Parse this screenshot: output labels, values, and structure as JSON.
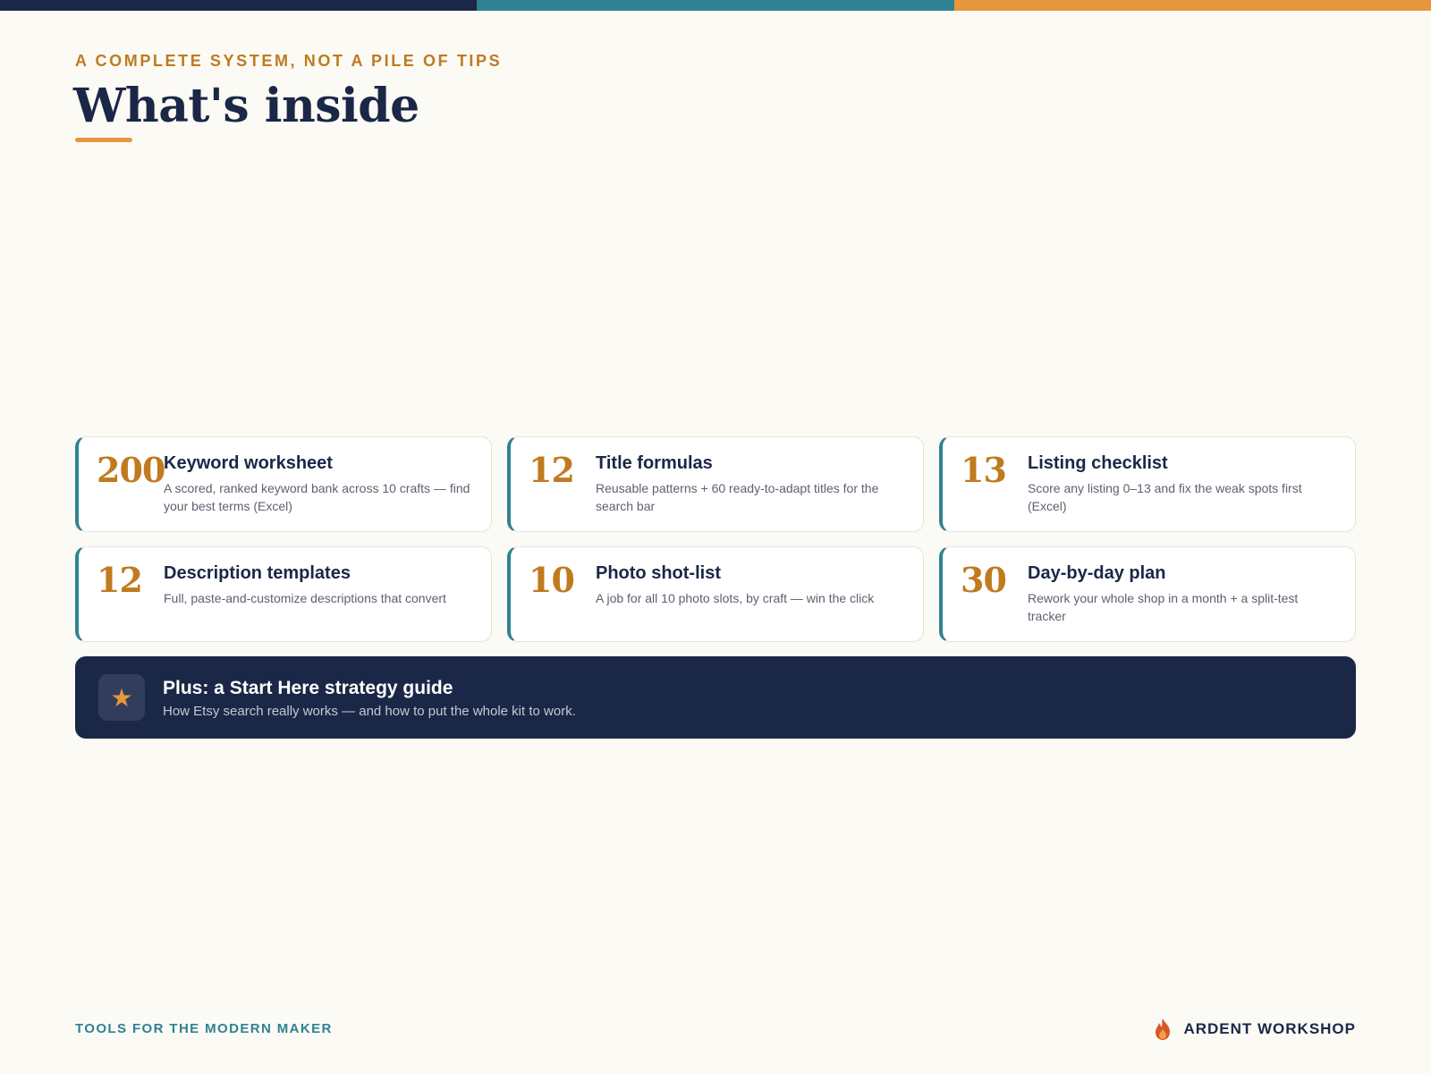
{
  "colors": {
    "navy": "#1b2747",
    "teal": "#2e8293",
    "orange": "#e8963c",
    "gold": "#c07a1f",
    "background": "#fbfaf4"
  },
  "header": {
    "eyebrow": "A COMPLETE SYSTEM, NOT A PILE OF TIPS",
    "title": "What's inside"
  },
  "cards": [
    {
      "number": "200",
      "title": "Keyword worksheet",
      "description": "A scored, ranked keyword bank across 10 crafts — find your best terms (Excel)"
    },
    {
      "number": "12",
      "title": "Title formulas",
      "description": "Reusable patterns + 60 ready-to-adapt titles for the search bar"
    },
    {
      "number": "13",
      "title": "Listing checklist",
      "description": "Score any listing 0–13 and fix the weak spots first (Excel)"
    },
    {
      "number": "12",
      "title": "Description templates",
      "description": "Full, paste-and-customize descriptions that convert"
    },
    {
      "number": "10",
      "title": "Photo shot-list",
      "description": "A job for all 10 photo slots, by craft — win the click"
    },
    {
      "number": "30",
      "title": "Day-by-day plan",
      "description": "Rework your whole shop in a month + a split-test tracker"
    }
  ],
  "plus": {
    "icon": "star-icon",
    "title": "Plus: a Start Here strategy guide",
    "description": "How Etsy search really works — and how to put the whole kit to work."
  },
  "footer": {
    "tagline": "TOOLS FOR THE MODERN MAKER",
    "brand_icon": "flame-icon",
    "brand": "ARDENT WORKSHOP"
  }
}
